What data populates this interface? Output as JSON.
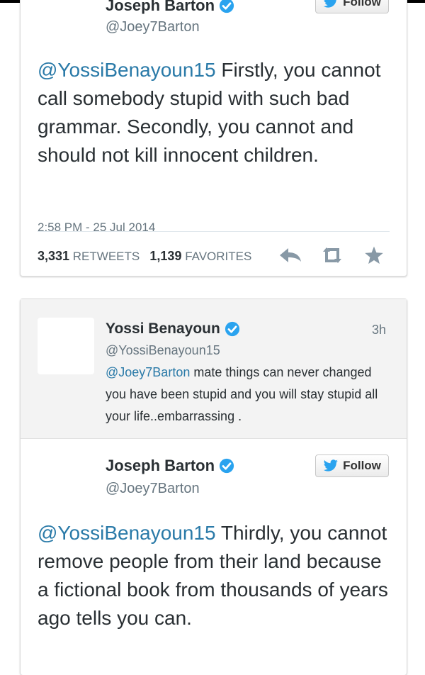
{
  "tweet1": {
    "name": "Joseph Barton",
    "handle": "@Joey7Barton",
    "follow_label": "Follow",
    "mention": "@YossiBenayoun15",
    "text": " Firstly, you cannot call somebody stupid with such bad grammar. Secondly, you cannot and should not kill innocent children.",
    "timestamp": "2:58 PM - 25 Jul 2014",
    "retweets_count": "3,331",
    "retweets_label": "RETWEETS",
    "favorites_count": "1,139",
    "favorites_label": "FAVORITES",
    "icons": [
      "reply-icon",
      "retweet-icon",
      "favorite-icon"
    ]
  },
  "reply": {
    "name": "Yossi Benayoun",
    "handle": "@YossiBenayoun15",
    "time": "3h",
    "mention": "@Joey7Barton",
    "text": " mate things can never changed  you have been stupid and you will stay stupid all your life..embarrassing ."
  },
  "tweet2": {
    "name": "Joseph Barton",
    "handle": "@Joey7Barton",
    "follow_label": "Follow",
    "mention": "@YossiBenayoun15",
    "text": " Thirdly, you cannot remove people from their land because a fictional book from thousands of years ago tells you can."
  },
  "colors": {
    "link": "#2a7aa8",
    "verified": "#2aa3ef",
    "twitter_bird": "#2aa3ef",
    "text": "#292f33",
    "muted": "#66757f"
  }
}
